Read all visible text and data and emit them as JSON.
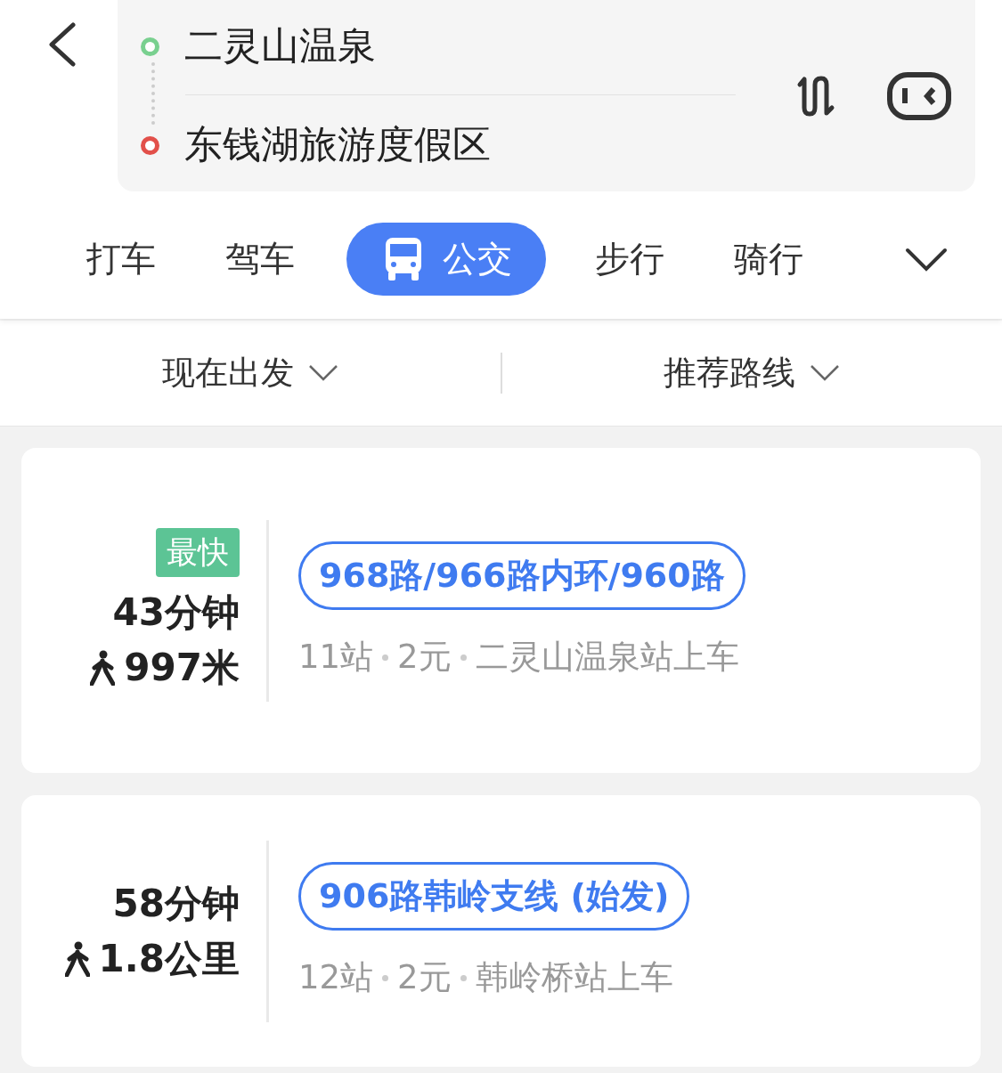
{
  "route": {
    "origin": "二灵山温泉",
    "destination": "东钱湖旅游度假区"
  },
  "tabs": [
    {
      "label": "打车",
      "selected": false
    },
    {
      "label": "驾车",
      "selected": false
    },
    {
      "label": "公交",
      "selected": true
    },
    {
      "label": "步行",
      "selected": false
    },
    {
      "label": "骑行",
      "selected": false
    }
  ],
  "filters": [
    "现在出发",
    "推荐路线"
  ],
  "routes": [
    {
      "badge": "最快",
      "duration": "43分钟",
      "walk": "997米",
      "lines": "968路/966路内环/960路",
      "details": [
        "11站",
        "2元",
        "二灵山温泉站上车"
      ]
    },
    {
      "duration": "58分钟",
      "walk": "1.8公里",
      "lines": "906路韩岭支线 (始发)",
      "details": [
        "12站",
        "2元",
        "韩岭桥站上车"
      ]
    }
  ]
}
